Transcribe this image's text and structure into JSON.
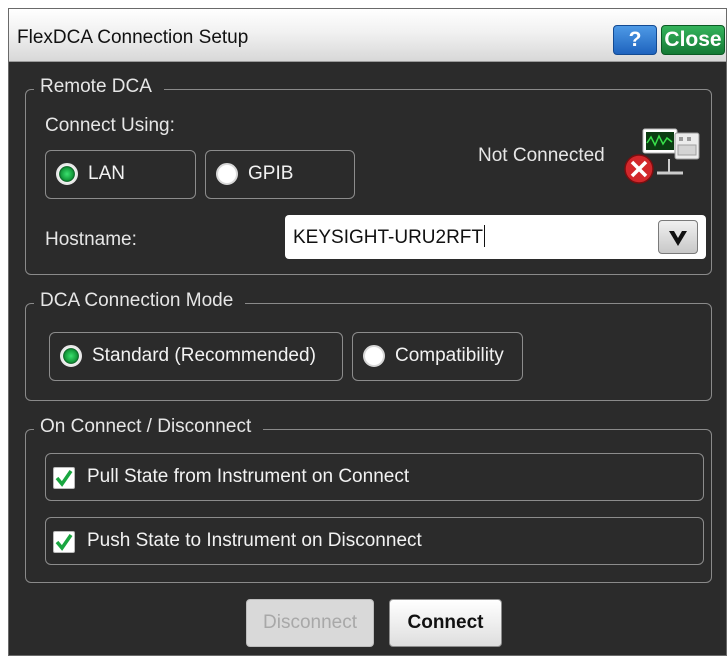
{
  "window": {
    "title": "FlexDCA Connection Setup",
    "help_label": "?",
    "close_label": "Close"
  },
  "remote_dca": {
    "legend": "Remote DCA",
    "connect_using_label": "Connect Using:",
    "options": [
      {
        "label": "LAN",
        "selected": true
      },
      {
        "label": "GPIB",
        "selected": false
      }
    ],
    "status": "Not Connected",
    "status_icon": "network-disconnected-icon",
    "hostname_label": "Hostname:",
    "hostname_value": "KEYSIGHT-URU2RFT"
  },
  "connection_mode": {
    "legend": "DCA Connection Mode",
    "options": [
      {
        "label": "Standard (Recommended)",
        "selected": true
      },
      {
        "label": "Compatibility",
        "selected": false
      }
    ]
  },
  "on_connect": {
    "legend": "On Connect / Disconnect",
    "items": [
      {
        "label": "Pull State from Instrument on Connect",
        "checked": true
      },
      {
        "label": "Push State to Instrument on Disconnect",
        "checked": true
      }
    ]
  },
  "buttons": {
    "disconnect": "Disconnect",
    "connect": "Connect"
  },
  "colors": {
    "panel_bg": "#2b2b2b",
    "selected_radio": "#139a3b",
    "check_mark": "#19a640",
    "help_button": "#1f63be",
    "close_button": "#157a36"
  }
}
